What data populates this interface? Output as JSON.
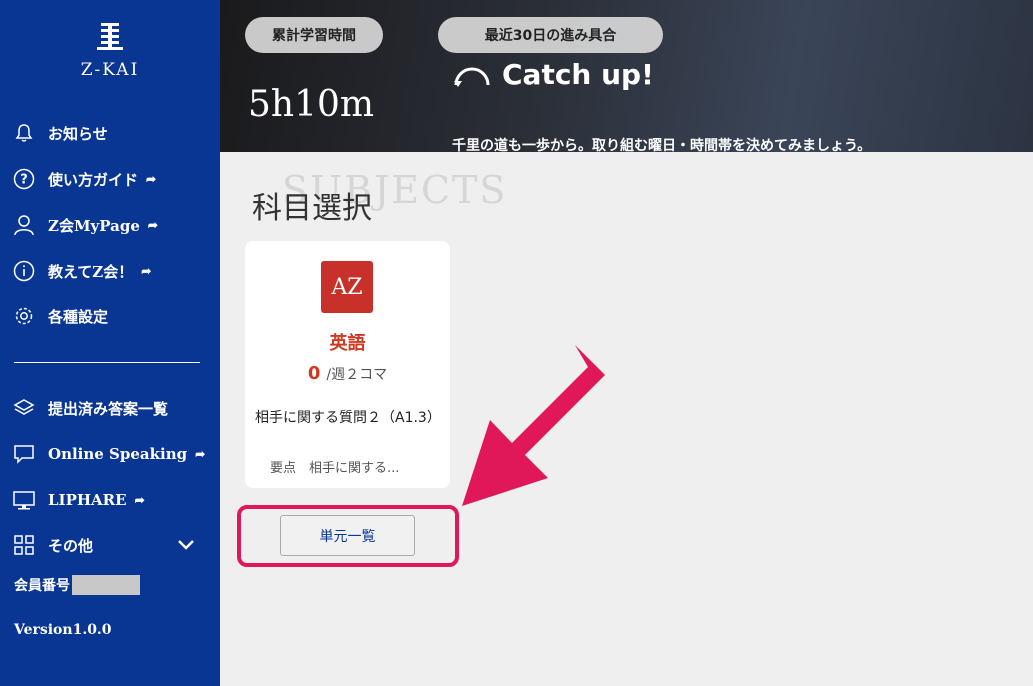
{
  "brand": {
    "logo_text": "Z-KAI"
  },
  "sidebar": {
    "items": [
      {
        "label": "お知らせ",
        "icon": "bell-icon",
        "external": false
      },
      {
        "label": "使い方ガイド",
        "icon": "help-icon",
        "external": true
      },
      {
        "label": "Z会MyPage",
        "icon": "user-icon",
        "external": true
      },
      {
        "label": "教えてZ会！",
        "icon": "info-icon",
        "external": true
      },
      {
        "label": "各種設定",
        "icon": "gear-icon",
        "external": false
      }
    ],
    "items2": [
      {
        "label": "提出済み答案一覧",
        "icon": "stack-icon",
        "external": false
      },
      {
        "label": "Online Speaking",
        "icon": "chat-icon",
        "external": true
      },
      {
        "label": "LIPHARE",
        "icon": "monitor-icon",
        "external": true
      },
      {
        "label": "その他",
        "icon": "grid-icon",
        "external": false
      }
    ],
    "member_label": "会員番号",
    "version": "Version1.0.0"
  },
  "hero": {
    "time_label": "累計学習時間",
    "progress_label": "最近30日の進み具合",
    "hours": "5h10m",
    "status": "Catch up!",
    "message": "千里の道も一歩から。取り組む曜日・時間帯を決めてみましょう。"
  },
  "section": {
    "bg_text": "SUBJECTS",
    "title": "科目選択"
  },
  "card": {
    "icon_text": "AZ",
    "subject": "英語",
    "count": "0",
    "count_unit": "/週２コマ",
    "lesson": "相手に関する質問２（A1.3）",
    "point": "要点　相手に関する..."
  },
  "unit_button": {
    "label": "単元一覧"
  },
  "colors": {
    "sidebar": "#0a3693",
    "accent": "#d0391f",
    "highlight": "#e0185a"
  }
}
